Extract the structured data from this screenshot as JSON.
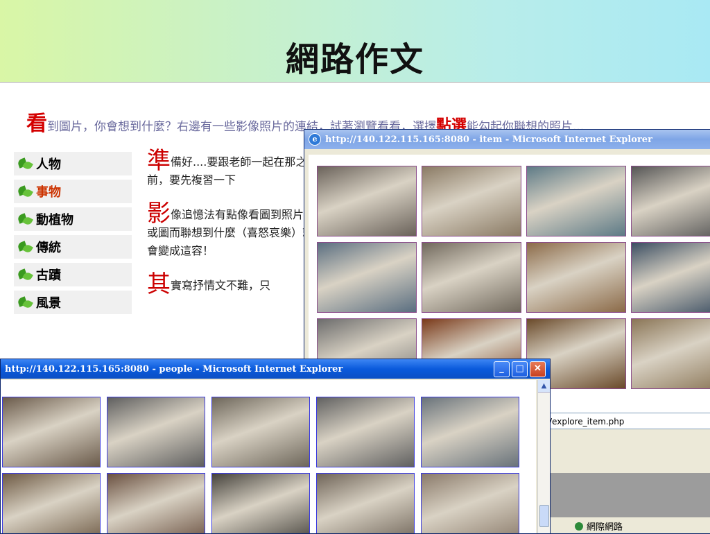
{
  "slide": {
    "title": "網路作文"
  },
  "page": {
    "instruction": {
      "cap1": "看",
      "text1": "到圖片，你會想到什麼？右邊有一些影像照片的連結，試著瀏覽看看，選擇",
      "cap2": "點選",
      "text2": "能勾起你聯想的照片..."
    },
    "menu": [
      {
        "label": "人物",
        "active": false
      },
      {
        "label": "事物",
        "active": true
      },
      {
        "label": "動植物",
        "active": false
      },
      {
        "label": "傳統",
        "active": false
      },
      {
        "label": "古蹟",
        "active": false
      },
      {
        "label": "風景",
        "active": false
      }
    ],
    "paragraphs": [
      {
        "cap": "準",
        "text": "備好....要跟老師一起在那之前，要先複習一下"
      },
      {
        "cap": "影",
        "text": "像追憶法有點像看圖到照片或圖而聯想到什麼（喜怒哀樂）就會變成這容！"
      },
      {
        "cap": "其",
        "text": "實寫抒情文不難，只"
      }
    ]
  },
  "window_item": {
    "title": "http://140.122.115.165:8080 - item - Microsoft Internet Explorer",
    "address_fragment": "/explore_item.php",
    "status_zone": "網際網路",
    "thumbs": [
      {
        "name": "thumb-item-ox-carts",
        "tone": "#6a625a"
      },
      {
        "name": "thumb-item-station",
        "tone": "#8a7a64"
      },
      {
        "name": "thumb-item-bridge",
        "tone": "#5d7a86"
      },
      {
        "name": "thumb-item-steam-train",
        "tone": "#555"
      },
      {
        "name": "thumb-item-water-buffalo",
        "tone": "#5a6e80"
      },
      {
        "name": "thumb-item-railcar",
        "tone": "#70685c"
      },
      {
        "name": "thumb-item-quarry",
        "tone": "#8b6a48"
      },
      {
        "name": "thumb-item-locomotive",
        "tone": "#3b4e62"
      },
      {
        "name": "thumb-item-engine",
        "tone": "#6c6c6c"
      },
      {
        "name": "thumb-item-temple-carving",
        "tone": "#7a3a1a"
      },
      {
        "name": "thumb-item-statue",
        "tone": "#6a4a2a"
      },
      {
        "name": "thumb-item-dancers",
        "tone": "#8a7556"
      }
    ]
  },
  "window_people": {
    "title": "http://140.122.115.165:8080 - people - Microsoft Internet Explorer",
    "thumbs": [
      {
        "name": "thumb-people-wedding-couple",
        "tone": "#6a5a4a"
      },
      {
        "name": "thumb-people-wedding-group",
        "tone": "#5e5e5e"
      },
      {
        "name": "thumb-people-village-group",
        "tone": "#6d665a"
      },
      {
        "name": "thumb-people-farm-crowd",
        "tone": "#606060"
      },
      {
        "name": "thumb-people-field-workers",
        "tone": "#68727a"
      },
      {
        "name": "thumb-people-ox-plowing",
        "tone": "#6e5a44"
      },
      {
        "name": "thumb-people-train-passengers",
        "tone": "#6a5040"
      },
      {
        "name": "thumb-people-tribal-bridge",
        "tone": "#45423c"
      },
      {
        "name": "thumb-people-sculpture",
        "tone": "#6f6458"
      },
      {
        "name": "thumb-people-canoes",
        "tone": "#8a7a6a"
      }
    ]
  }
}
